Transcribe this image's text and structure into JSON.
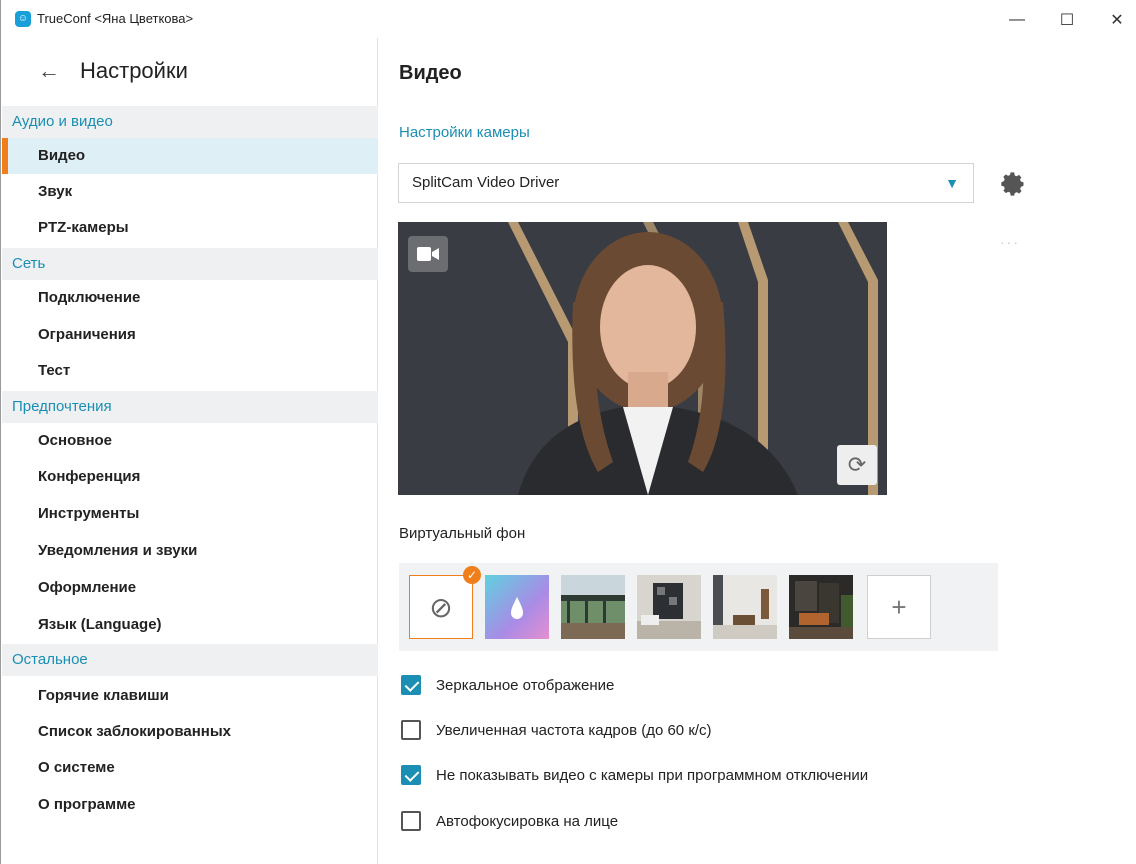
{
  "window": {
    "title": "TrueConf <Яна Цветкова>",
    "app_icon": "trueconf-logo-icon",
    "minimize": "—",
    "maximize": "☐",
    "close": "✕"
  },
  "sidebar": {
    "title": "Настройки",
    "sections": [
      {
        "label": "Аудио и видео",
        "items": [
          "Видео",
          "Звук",
          "PTZ-камеры"
        ]
      },
      {
        "label": "Сеть",
        "items": [
          "Подключение",
          "Ограничения",
          "Тест"
        ]
      },
      {
        "label": "Предпочтения",
        "items": [
          "Основное",
          "Конференция",
          "Инструменты",
          "Уведомления и звуки",
          "Оформление",
          "Язык (Language)"
        ]
      },
      {
        "label": "Остальное",
        "items": [
          "Горячие клавиши",
          "Список заблокированных",
          "О системе",
          "О программе"
        ]
      }
    ],
    "active_item": "Видео"
  },
  "main": {
    "title": "Видео",
    "camera_heading": "Настройки камеры",
    "camera_select": "SplitCam Video Driver",
    "virtual_bg_label": "Виртуальный фон",
    "virtual_bg_options": [
      "none",
      "blur",
      "room-1",
      "room-2",
      "room-3",
      "room-4"
    ],
    "selected_bg": "none",
    "add_bg": "+",
    "checkboxes": [
      {
        "label": "Зеркальное отображение",
        "checked": true
      },
      {
        "label": "Увеличенная частота кадров (до 60 к/с)",
        "checked": false
      },
      {
        "label": "Не показывать видео с камеры при программном отключении",
        "checked": true
      },
      {
        "label": "Автофокусировка на лице",
        "checked": false
      }
    ]
  },
  "colors": {
    "accent": "#1b8fb3",
    "active_marker": "#f07e1a",
    "active_bg": "#dfeff6",
    "section_bg": "#eef0f2"
  }
}
